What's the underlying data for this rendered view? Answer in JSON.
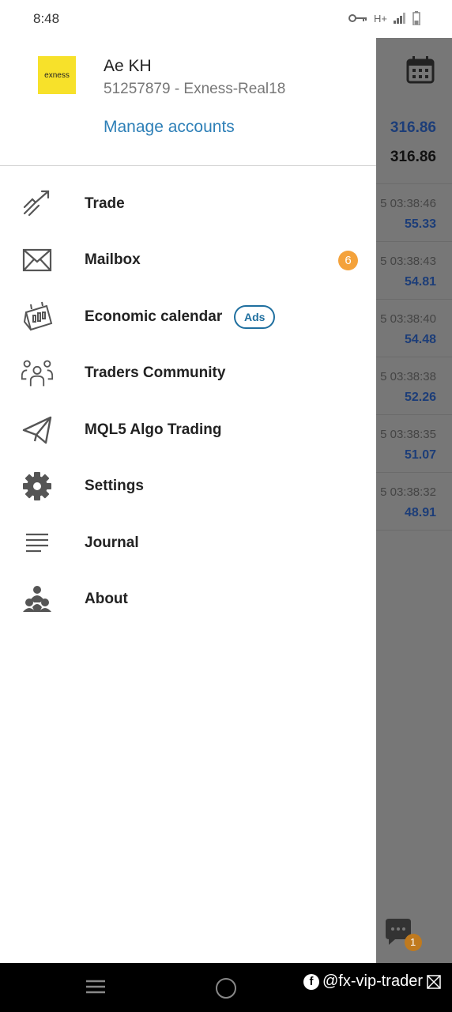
{
  "status": {
    "time": "8:48",
    "network": "H+"
  },
  "background": {
    "prices": [
      "316.86",
      "316.86"
    ],
    "rows": [
      {
        "time": "5 03:38:46",
        "value": "55.33"
      },
      {
        "time": "5 03:38:43",
        "value": "54.81"
      },
      {
        "time": "5 03:38:40",
        "value": "54.48"
      },
      {
        "time": "5 03:38:38",
        "value": "52.26"
      },
      {
        "time": "5 03:38:35",
        "value": "51.07"
      },
      {
        "time": "5 03:38:32",
        "value": "48.91"
      }
    ],
    "chat_badge": "1"
  },
  "account": {
    "logo_text": "exness",
    "name": "Ae KH",
    "details": "51257879 - Exness-Real18",
    "manage_label": "Manage accounts"
  },
  "menu": [
    {
      "label": "Trade",
      "icon": "trade-icon"
    },
    {
      "label": "Mailbox",
      "icon": "mail-icon",
      "badge": "6"
    },
    {
      "label": "Economic calendar",
      "icon": "calendar-icon",
      "tag": "Ads"
    },
    {
      "label": "Traders Community",
      "icon": "community-icon"
    },
    {
      "label": "MQL5 Algo Trading",
      "icon": "paper-plane-icon"
    },
    {
      "label": "Settings",
      "icon": "gear-icon"
    },
    {
      "label": "Journal",
      "icon": "journal-icon"
    },
    {
      "label": "About",
      "icon": "about-icon"
    }
  ],
  "watermark": "@fx-vip-trader"
}
